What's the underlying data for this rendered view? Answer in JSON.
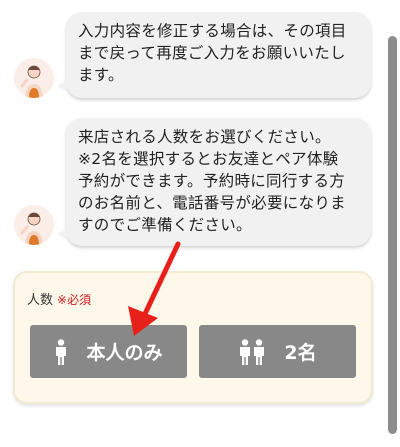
{
  "messages": [
    {
      "text": "入力内容を修正する場合は、その項目\nまで戻って再度ご入力をお願いいたし\nます。"
    },
    {
      "text": "来店される人数をお選びください。\n※2名を選択するとお友達とペア体験\n予約ができます。予約時に同行する方\nのお名前と、電話番号が必要になりま\nすのでご準備ください。"
    }
  ],
  "form": {
    "label": "人数",
    "required": "※必須",
    "options": [
      {
        "label": "本人のみ",
        "icon": "person-icon"
      },
      {
        "label": "2名",
        "icon": "two-people-icon"
      }
    ]
  },
  "colors": {
    "bubble": "#f1f1f1",
    "button": "#888888",
    "card": "#fdf8ea",
    "required": "#d11a1a",
    "arrow": "#e8201c"
  }
}
